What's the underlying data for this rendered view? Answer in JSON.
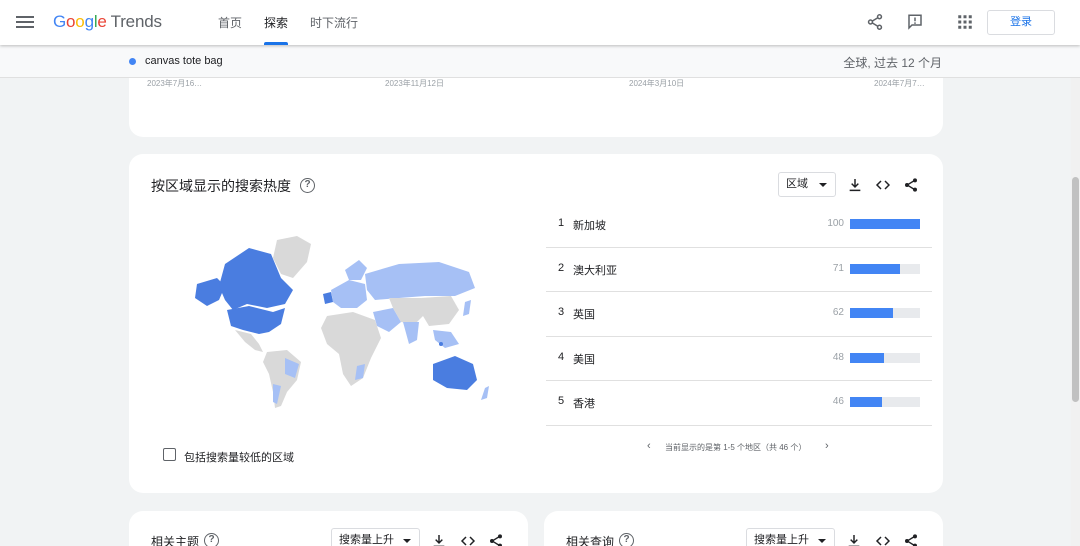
{
  "header": {
    "logo_google": [
      "G",
      "o",
      "o",
      "g",
      "l",
      "e"
    ],
    "logo_trends": "Trends",
    "tabs": [
      {
        "label": "首页",
        "active": false
      },
      {
        "label": "探索",
        "active": true
      },
      {
        "label": "时下流行",
        "active": false
      }
    ],
    "login_label": "登录",
    "icons": [
      "menu-icon",
      "share-icon",
      "feedback-icon",
      "apps-icon"
    ]
  },
  "subbar": {
    "term": "canvas tote bag",
    "term_color": "#4285f4",
    "scope": "全球, 过去 12 个月"
  },
  "top_chart": {
    "x_ticks": [
      "2023年7月16…",
      "2023年11月12日",
      "2024年3月10日",
      "2024年7月7…"
    ]
  },
  "region_card": {
    "title": "按区域显示的搜索热度",
    "resolution_select": "区域",
    "tools": [
      "download-icon",
      "embed-icon",
      "share-icon"
    ],
    "include_low_volume_label": "包括搜索量较低的区域",
    "include_low_volume_checked": false,
    "rankings": [
      {
        "rank": "1",
        "name": "新加坡",
        "value": "100"
      },
      {
        "rank": "2",
        "name": "澳大利亚",
        "value": "71"
      },
      {
        "rank": "3",
        "name": "英国",
        "value": "62"
      },
      {
        "rank": "4",
        "name": "美国",
        "value": "48"
      },
      {
        "rank": "5",
        "name": "香港",
        "value": "46"
      }
    ],
    "bar_color": "#4285f4",
    "pager_text": "当前显示的是第 1-5 个地区（共 46 个）",
    "pager_prev": "‹",
    "pager_next": "›",
    "map_colors": {
      "high": "#4a7de0",
      "mid": "#a6c0f5",
      "none": "#d9d9d9"
    }
  },
  "related_topics": {
    "title": "相关主题",
    "select": "搜索量上升"
  },
  "related_queries": {
    "title": "相关查询",
    "select": "搜索量上升"
  }
}
